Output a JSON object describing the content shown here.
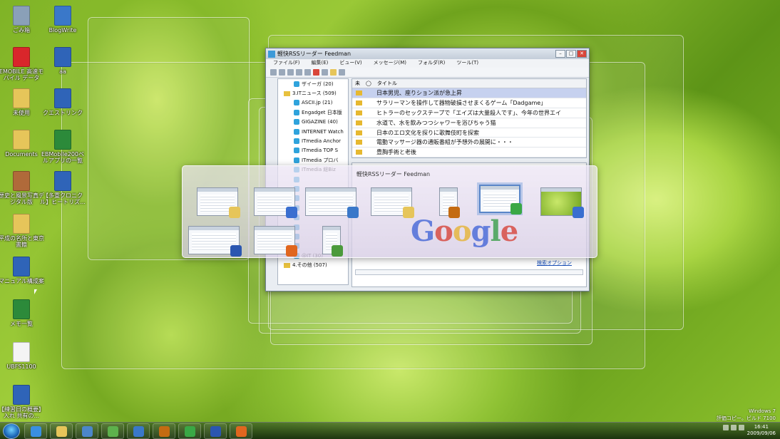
{
  "desktop_icons": [
    {
      "label": "ごみ箱",
      "icon": "recycle-bin-icon",
      "color": "#8aa0b8"
    },
    {
      "label": "BlogWrite",
      "icon": "blogwrite-icon",
      "color": "#3a78c9"
    },
    {
      "label": "EMOBILE 高速モバイル データ",
      "icon": "emobile-icon",
      "color": "#d9262b"
    },
    {
      "label": "aa",
      "icon": "word-doc-icon",
      "color": "#2f64b8"
    },
    {
      "label": "未使用",
      "icon": "folder-icon",
      "color": "#e6c55a"
    },
    {
      "label": "クエストリンク",
      "icon": "word-doc-icon",
      "color": "#2f64b8"
    },
    {
      "label": "Documents",
      "icon": "folder-icon",
      "color": "#e6c55a"
    },
    {
      "label": "EBMobile200ベルアプリの一覧",
      "icon": "excel-doc-icon",
      "color": "#2c8a3a"
    },
    {
      "label": "歴史と風景写真デジタル版",
      "icon": "book-icon",
      "color": "#b06a3a"
    },
    {
      "label": "【多重クロニクル】ヒートリズ...",
      "icon": "word-doc-icon",
      "color": "#2f64b8"
    },
    {
      "label": "平成の名所と東京書籍",
      "icon": "folder-icon",
      "color": "#e6c55a"
    },
    {
      "label": "マニュアル構成案",
      "icon": "word-doc-icon",
      "color": "#2f64b8"
    },
    {
      "label": "メモ一覧",
      "icon": "excel-doc-icon",
      "color": "#2c8a3a"
    },
    {
      "label": "UBFS1100",
      "icon": "blank-doc-icon",
      "color": "#f4f4f4"
    },
    {
      "label": "【練習日の概要】入れ 共有の...",
      "icon": "word-doc-icon",
      "color": "#2f64b8"
    }
  ],
  "app_window": {
    "title": "軽快RSSリーダー Feedman",
    "menu": [
      "ファイル(F)",
      "編集(E)",
      "ビュー(V)",
      "メッセージ(M)",
      "フォルダ(R)",
      "ツール(T)"
    ],
    "tree": [
      {
        "label": "ザイーガ (20)",
        "kind": "feed"
      },
      {
        "label": "3.ITニュース (509)",
        "kind": "folder"
      },
      {
        "label": "ASCII.jp (21)",
        "kind": "feed"
      },
      {
        "label": "Engadget 日本版",
        "kind": "feed"
      },
      {
        "label": "GIGAZINE (40)",
        "kind": "feed"
      },
      {
        "label": "INTERNET Watch",
        "kind": "feed"
      },
      {
        "label": "ITmedia Anchor",
        "kind": "feed"
      },
      {
        "label": "ITmedia TOP S",
        "kind": "feed"
      },
      {
        "label": "ITmedia プロバ",
        "kind": "feed"
      },
      {
        "label": "ITmedia 総Biz",
        "kind": "feed"
      },
      {
        "label": "",
        "kind": "feed"
      },
      {
        "label": "",
        "kind": "feed"
      },
      {
        "label": "",
        "kind": "feed"
      },
      {
        "label": "",
        "kind": "feed"
      },
      {
        "label": "",
        "kind": "feed"
      },
      {
        "label": "",
        "kind": "feed"
      },
      {
        "label": "",
        "kind": "feed"
      },
      {
        "label": "",
        "kind": "feed"
      },
      {
        "label": "@IT (30)",
        "kind": "feed"
      },
      {
        "label": "4.その他 (507)",
        "kind": "folder"
      }
    ],
    "list_headers": [
      "未",
      "◯",
      "タイトル"
    ],
    "articles": [
      {
        "title": "日本男児、座りション派が急上昇",
        "selected": true
      },
      {
        "title": "サラリーマンを操作して器物破損させまくるゲーム「Dadgame」",
        "selected": false
      },
      {
        "title": "ヒトラーのセックステープで「エイズは大量殺人です」、今年の世界エイ",
        "selected": false
      },
      {
        "title": "水道で、水を飲みつつシャワーを浴びちゃう猫",
        "selected": false
      },
      {
        "title": "日本のエロ文化を探りに歌舞伎町を探索",
        "selected": false
      },
      {
        "title": "電動マッサージ器の通販番組が予想外の展開に・・・",
        "selected": false
      },
      {
        "title": "豊胸手術と老後",
        "selected": false
      }
    ],
    "detail_link": "検索オプション"
  },
  "switcher": {
    "title": "軽快RSSリーダー Feedman",
    "google_text": "Google",
    "thumbnails": [
      {
        "name": "explorer-window",
        "badge": "#e6c55a",
        "active": false
      },
      {
        "name": "network-window",
        "badge": "#3a6fd0",
        "active": false
      },
      {
        "name": "ie-window",
        "badge": "#3a78c9",
        "active": false
      },
      {
        "name": "folder-window",
        "badge": "#e6c55a",
        "active": false
      },
      {
        "name": "screenshot-app",
        "badge": "#c46b12",
        "active": false
      },
      {
        "name": "feedman-window",
        "badge": "#3aa845",
        "active": true
      },
      {
        "name": "desktop-preview",
        "badge": "#3a6fd0",
        "active": false
      },
      {
        "name": "blogwrite-window",
        "badge": "#2b56b0",
        "active": false
      },
      {
        "name": "firefox-window",
        "badge": "#e0661f",
        "active": false
      },
      {
        "name": "messenger-window",
        "badge": "#4b9a3c",
        "active": false
      }
    ]
  },
  "taskbar": {
    "apps": [
      {
        "name": "ie",
        "color": "#3a8fe0"
      },
      {
        "name": "explorer",
        "color": "#e6c55a"
      },
      {
        "name": "settings",
        "color": "#4c86c9"
      },
      {
        "name": "messenger",
        "color": "#5db14c"
      },
      {
        "name": "blogwrite",
        "color": "#3a78c9"
      },
      {
        "name": "screenshot",
        "color": "#c46b12"
      },
      {
        "name": "feedman",
        "color": "#3aa845"
      },
      {
        "name": "blog-tool",
        "color": "#2b56b0"
      },
      {
        "name": "firefox",
        "color": "#e0661f"
      }
    ],
    "time": "16:41",
    "date": "2009/09/06"
  },
  "watermark": {
    "line1": "Windows 7",
    "line2": "評価コピー。ビルド 7100"
  }
}
